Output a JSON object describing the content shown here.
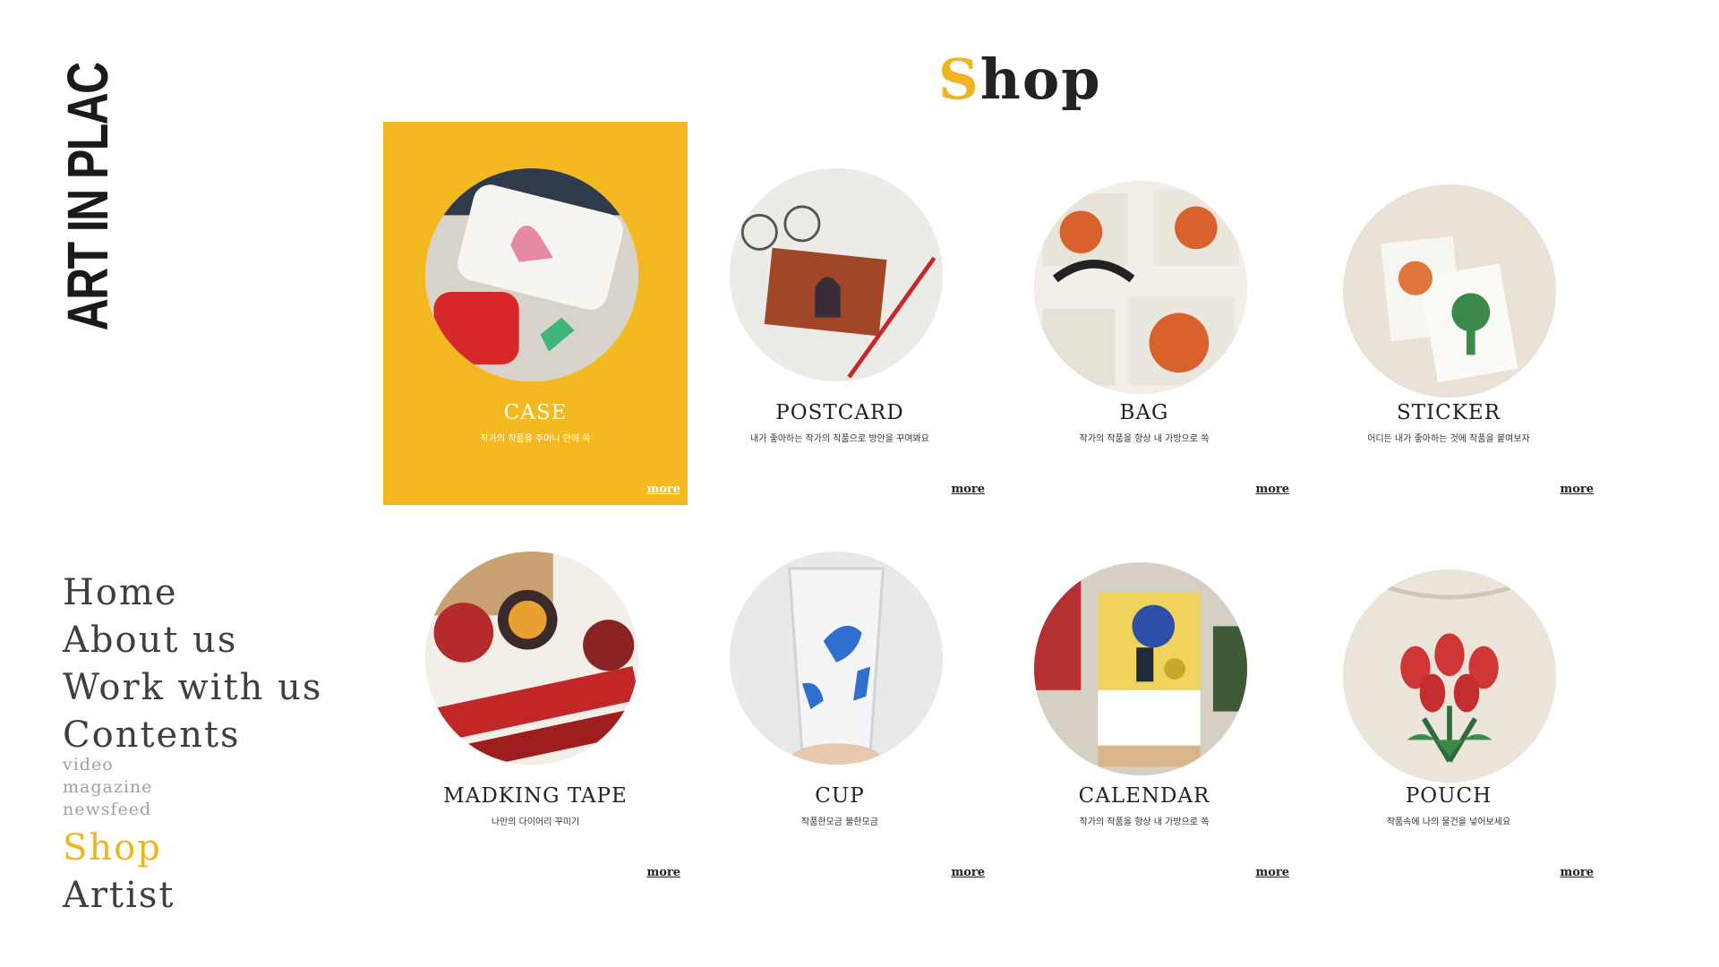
{
  "brand": {
    "logo_text": "ART IN PLACE"
  },
  "nav": {
    "items": [
      {
        "label": "Home"
      },
      {
        "label": "About us"
      },
      {
        "label": "Work with us"
      },
      {
        "label": "Contents"
      },
      {
        "label": "Shop"
      },
      {
        "label": "Artist"
      }
    ],
    "sub_items": [
      {
        "label": "video"
      },
      {
        "label": "magazine"
      },
      {
        "label": "newsfeed"
      }
    ],
    "active": "Shop"
  },
  "page": {
    "title_initial": "S",
    "title_rest": "hop"
  },
  "products": [
    {
      "title": "CASE",
      "description": "작가의 작품을 주머니 안에 쏙",
      "more_label": "more",
      "image_icon": "phone-case-image",
      "highlighted": true
    },
    {
      "title": "POSTCARD",
      "description": "내가 좋아하는 작가의 작품으로 방안을 꾸며봐요",
      "more_label": "more",
      "image_icon": "postcard-image",
      "highlighted": false
    },
    {
      "title": "BAG",
      "description": "작가의 작품을 항상 내 가방으로 쏙",
      "more_label": "more",
      "image_icon": "bag-image",
      "highlighted": false
    },
    {
      "title": "STICKER",
      "description": "어디든 내가 좋아하는 것에 작품을 붙여보자",
      "more_label": "more",
      "image_icon": "sticker-image",
      "highlighted": false
    },
    {
      "title": "MADKING TAPE",
      "description": "나만의 다이어리 꾸미기",
      "more_label": "more",
      "image_icon": "tape-image",
      "highlighted": false
    },
    {
      "title": "CUP",
      "description": "작품한모금 불한모금",
      "more_label": "more",
      "image_icon": "cup-image",
      "highlighted": false
    },
    {
      "title": "CALENDAR",
      "description": "작가의 작품을 항상 내 가방으로 쏙",
      "more_label": "more",
      "image_icon": "calendar-image",
      "highlighted": false
    },
    {
      "title": "POUCH",
      "description": "작품속에 나의 물건을 넣어보세요",
      "more_label": "more",
      "image_icon": "pouch-image",
      "highlighted": false
    }
  ],
  "colors": {
    "accent": "#f0b420",
    "card_highlight": "#f4b920",
    "text_dark": "#222222",
    "nav_text": "#3f3f3f",
    "nav_sub_text": "#a0a0a0"
  }
}
